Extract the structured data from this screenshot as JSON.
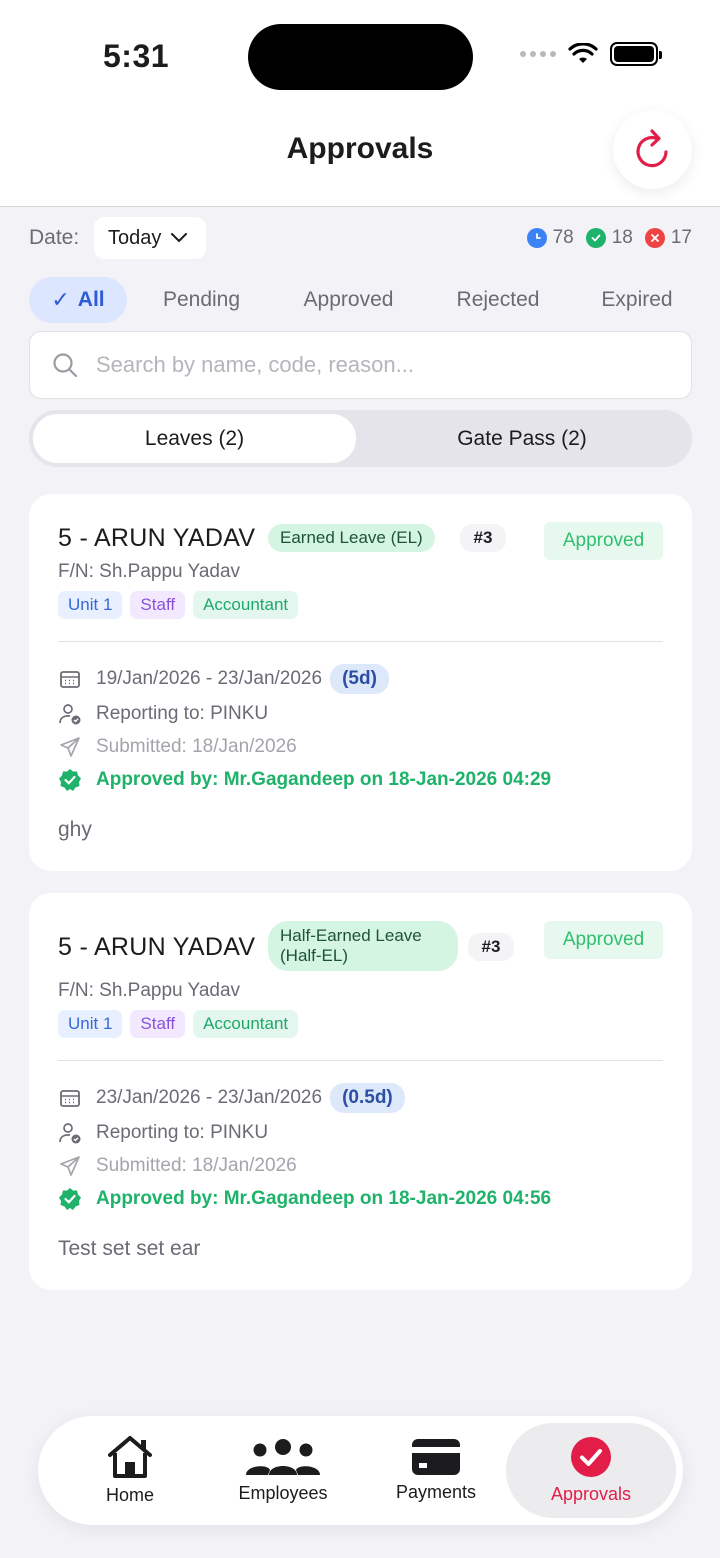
{
  "status_bar": {
    "time": "5:31"
  },
  "header": {
    "title": "Approvals"
  },
  "filters": {
    "date_label": "Date:",
    "date_value": "Today",
    "counts": {
      "pending": "78",
      "approved": "18",
      "rejected": "17"
    },
    "status_tabs": [
      "All",
      "Pending",
      "Approved",
      "Rejected",
      "Expired"
    ],
    "active_status_tab": "All"
  },
  "search": {
    "placeholder": "Search by name, code, reason..."
  },
  "segments": {
    "leaves": "Leaves (2)",
    "gate_pass": "Gate Pass (2)"
  },
  "cards": [
    {
      "name": "5 - ARUN YADAV",
      "leave_type": "Earned Leave (EL)",
      "number": "#3",
      "status": "Approved",
      "father_name": "F/N: Sh.Pappu Yadav",
      "tags": [
        "Unit 1",
        "Staff",
        "Accountant"
      ],
      "date_range": "19/Jan/2026 - 23/Jan/2026",
      "days": "(5d)",
      "reporting_to": "Reporting to: PINKU",
      "submitted": "Submitted: 18/Jan/2026",
      "approved_by": "Approved by: Mr.Gagandeep on 18-Jan-2026 04:29",
      "reason": "ghy"
    },
    {
      "name": "5 - ARUN YADAV",
      "leave_type": "Half-Earned Leave (Half-EL)",
      "number": "#3",
      "status": "Approved",
      "father_name": "F/N: Sh.Pappu Yadav",
      "tags": [
        "Unit 1",
        "Staff",
        "Accountant"
      ],
      "date_range": "23/Jan/2026 - 23/Jan/2026",
      "days": "(0.5d)",
      "reporting_to": "Reporting to: PINKU",
      "submitted": "Submitted: 18/Jan/2026",
      "approved_by": "Approved by: Mr.Gagandeep on 18-Jan-2026 04:56",
      "reason": "Test set set ear"
    }
  ],
  "nav": {
    "home": "Home",
    "employees": "Employees",
    "payments": "Payments",
    "approvals": "Approvals",
    "active": "approvals"
  },
  "colors": {
    "accent": "#e11d48",
    "approved": "#1fb26a",
    "pending": "#3b82f6",
    "rejected": "#ef4444",
    "tab_active": "#2f5bd3"
  }
}
